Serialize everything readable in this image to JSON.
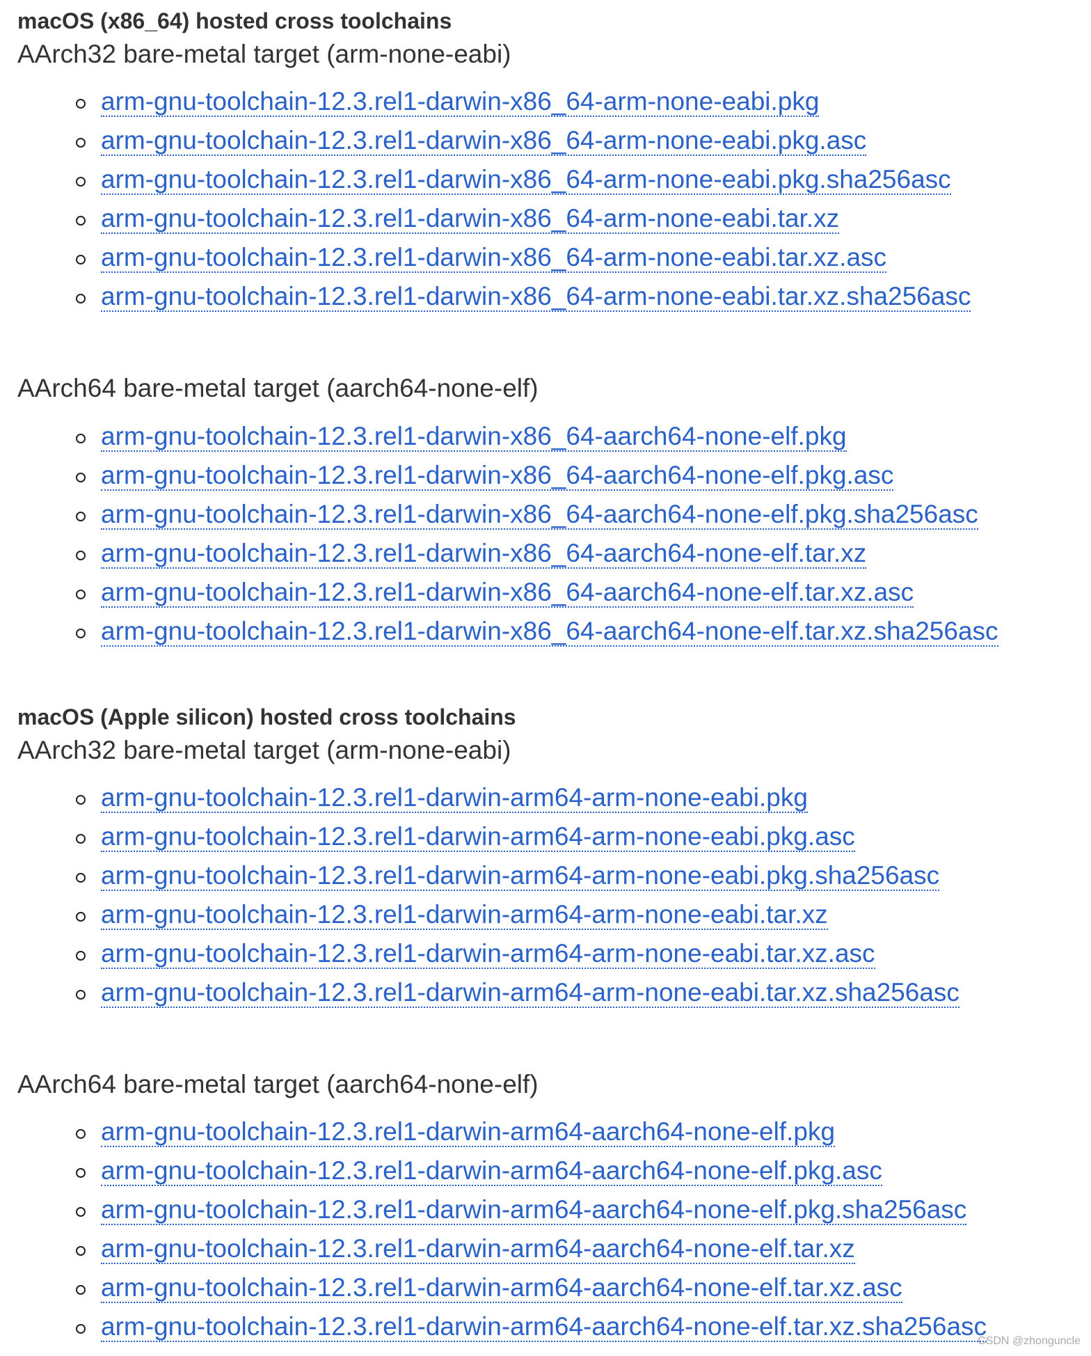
{
  "colors": {
    "link": "#2a62c9",
    "text": "#333333",
    "bullet": "#222222"
  },
  "sections": [
    {
      "heading": "macOS (x86_64) hosted cross toolchains",
      "groups": [
        {
          "title": "AArch32 bare-metal target (arm-none-eabi)",
          "links": [
            "arm-gnu-toolchain-12.3.rel1-darwin-x86_64-arm-none-eabi.pkg",
            "arm-gnu-toolchain-12.3.rel1-darwin-x86_64-arm-none-eabi.pkg.asc",
            "arm-gnu-toolchain-12.3.rel1-darwin-x86_64-arm-none-eabi.pkg.sha256asc",
            "arm-gnu-toolchain-12.3.rel1-darwin-x86_64-arm-none-eabi.tar.xz",
            "arm-gnu-toolchain-12.3.rel1-darwin-x86_64-arm-none-eabi.tar.xz.asc",
            "arm-gnu-toolchain-12.3.rel1-darwin-x86_64-arm-none-eabi.tar.xz.sha256asc"
          ]
        },
        {
          "title": "AArch64 bare-metal target (aarch64-none-elf)",
          "links": [
            "arm-gnu-toolchain-12.3.rel1-darwin-x86_64-aarch64-none-elf.pkg",
            "arm-gnu-toolchain-12.3.rel1-darwin-x86_64-aarch64-none-elf.pkg.asc",
            "arm-gnu-toolchain-12.3.rel1-darwin-x86_64-aarch64-none-elf.pkg.sha256asc",
            "arm-gnu-toolchain-12.3.rel1-darwin-x86_64-aarch64-none-elf.tar.xz",
            "arm-gnu-toolchain-12.3.rel1-darwin-x86_64-aarch64-none-elf.tar.xz.asc",
            "arm-gnu-toolchain-12.3.rel1-darwin-x86_64-aarch64-none-elf.tar.xz.sha256asc"
          ]
        }
      ]
    },
    {
      "heading": "macOS (Apple silicon) hosted cross toolchains",
      "groups": [
        {
          "title": "AArch32 bare-metal target (arm-none-eabi)",
          "links": [
            "arm-gnu-toolchain-12.3.rel1-darwin-arm64-arm-none-eabi.pkg",
            "arm-gnu-toolchain-12.3.rel1-darwin-arm64-arm-none-eabi.pkg.asc",
            "arm-gnu-toolchain-12.3.rel1-darwin-arm64-arm-none-eabi.pkg.sha256asc",
            "arm-gnu-toolchain-12.3.rel1-darwin-arm64-arm-none-eabi.tar.xz",
            "arm-gnu-toolchain-12.3.rel1-darwin-arm64-arm-none-eabi.tar.xz.asc",
            "arm-gnu-toolchain-12.3.rel1-darwin-arm64-arm-none-eabi.tar.xz.sha256asc"
          ]
        },
        {
          "title": "AArch64 bare-metal target (aarch64-none-elf)",
          "links": [
            "arm-gnu-toolchain-12.3.rel1-darwin-arm64-aarch64-none-elf.pkg",
            "arm-gnu-toolchain-12.3.rel1-darwin-arm64-aarch64-none-elf.pkg.asc",
            "arm-gnu-toolchain-12.3.rel1-darwin-arm64-aarch64-none-elf.pkg.sha256asc",
            "arm-gnu-toolchain-12.3.rel1-darwin-arm64-aarch64-none-elf.tar.xz",
            "arm-gnu-toolchain-12.3.rel1-darwin-arm64-aarch64-none-elf.tar.xz.asc",
            "arm-gnu-toolchain-12.3.rel1-darwin-arm64-aarch64-none-elf.tar.xz.sha256asc"
          ]
        }
      ]
    }
  ],
  "watermark": "CSDN @zhonguncle"
}
